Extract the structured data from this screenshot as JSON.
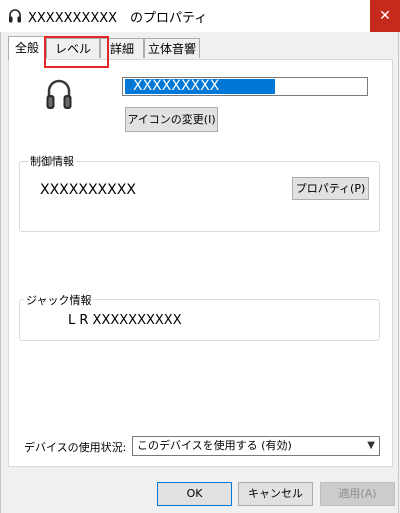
{
  "window": {
    "title": "XXXXXXXXXX　のプロパティ",
    "close_symbol": "✕",
    "icon": "headphones-icon",
    "close_color": "#c42b1c"
  },
  "tabs": [
    {
      "label": "全般",
      "active": true
    },
    {
      "label": "レベル",
      "active": false,
      "highlighted": true
    },
    {
      "label": "詳細",
      "active": false
    },
    {
      "label": "立体音響",
      "active": false
    }
  ],
  "highlight_color": "#e3262a",
  "general": {
    "device_name": "XXXXXXXXX",
    "change_icon_button": "アイコンの変更(I)",
    "controller_group_label": "制御情報",
    "controller_name": "XXXXXXXXXX",
    "properties_button": "プロパティ(P)",
    "jack_group_label": "ジャック情報",
    "jack_info": "L R XXXXXXXXXX",
    "usage_label": "デバイスの使用状況:",
    "usage_value": "このデバイスを使用する (有効)"
  },
  "footer": {
    "ok_label": "OK",
    "cancel_label": "キャンセル",
    "apply_label": "適用(A)"
  },
  "accent_color": "#0078d7"
}
